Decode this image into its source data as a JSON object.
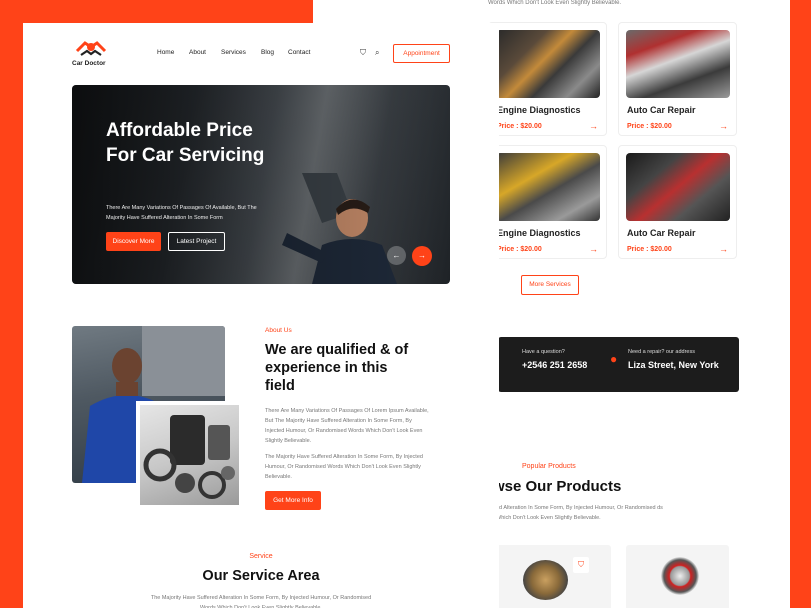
{
  "brand": {
    "name": "Car Doctor",
    "accent": "#ff4318",
    "dark": "#1c1c1c"
  },
  "nav": {
    "items": [
      "Home",
      "About",
      "Services",
      "Blog",
      "Contact"
    ],
    "cart_icon": "bag-icon",
    "search_icon": "search-icon",
    "appointment_label": "Appointment"
  },
  "hero": {
    "title": "Affordable Price For Car Servicing",
    "description": "There Are Many Variations Of Passages Of  Available, But The Majority Have Suffered Alteration In Some Form",
    "primary_button": "Discover More",
    "secondary_button": "Latest Project",
    "prev_icon": "arrow-left-icon",
    "next_icon": "arrow-right-icon"
  },
  "about": {
    "label": "About Us",
    "title": "We are qualified & of experience in this field",
    "paragraph1": "There Are Many Variations Of Passages Of Lorem Ipsum Available, But The Majority Have Suffered Alteration In Some Form, By Injected Humour, Or Randomised Words Which Don't Look Even Slightly Believable.",
    "paragraph2": "The Majority Have Suffered Alteration In Some Form, By Injected Humour, Or Randomised Words Which Don't Look Even Slightly Believable.",
    "button": "Get More Info"
  },
  "service_area": {
    "label": "Service",
    "title": "Our Service Area",
    "description": "The Majority Have Suffered Alteration In Some Form, By Injected Humour, Or Randomised Words Which Don't Look Even Slightly Believable."
  },
  "back_page": {
    "top_text": "Words Which Don't Look Even Slightly Believable.",
    "services": [
      {
        "title": "Engine Diagnostics",
        "price": "Price : $20.00"
      },
      {
        "title": "Auto Car Repair",
        "price": "Price : $20.00"
      },
      {
        "title": "Engine Diagnostics",
        "price": "Price : $20.00"
      },
      {
        "title": "Auto Car Repair",
        "price": "Price : $20.00"
      }
    ],
    "more_services": "More Services",
    "contact": {
      "question_label": "Have a question?",
      "phone": "+2546 251 2658",
      "address_label": "Need a repair? our address",
      "address": "Liza Street, New York"
    },
    "products": {
      "label": "Popular Products",
      "title": "wse Our Products",
      "description": "ed Alteration In Some Form, By Injected Humour, Or Randomised ds Which Don't Look Even Slightly Believable."
    }
  }
}
